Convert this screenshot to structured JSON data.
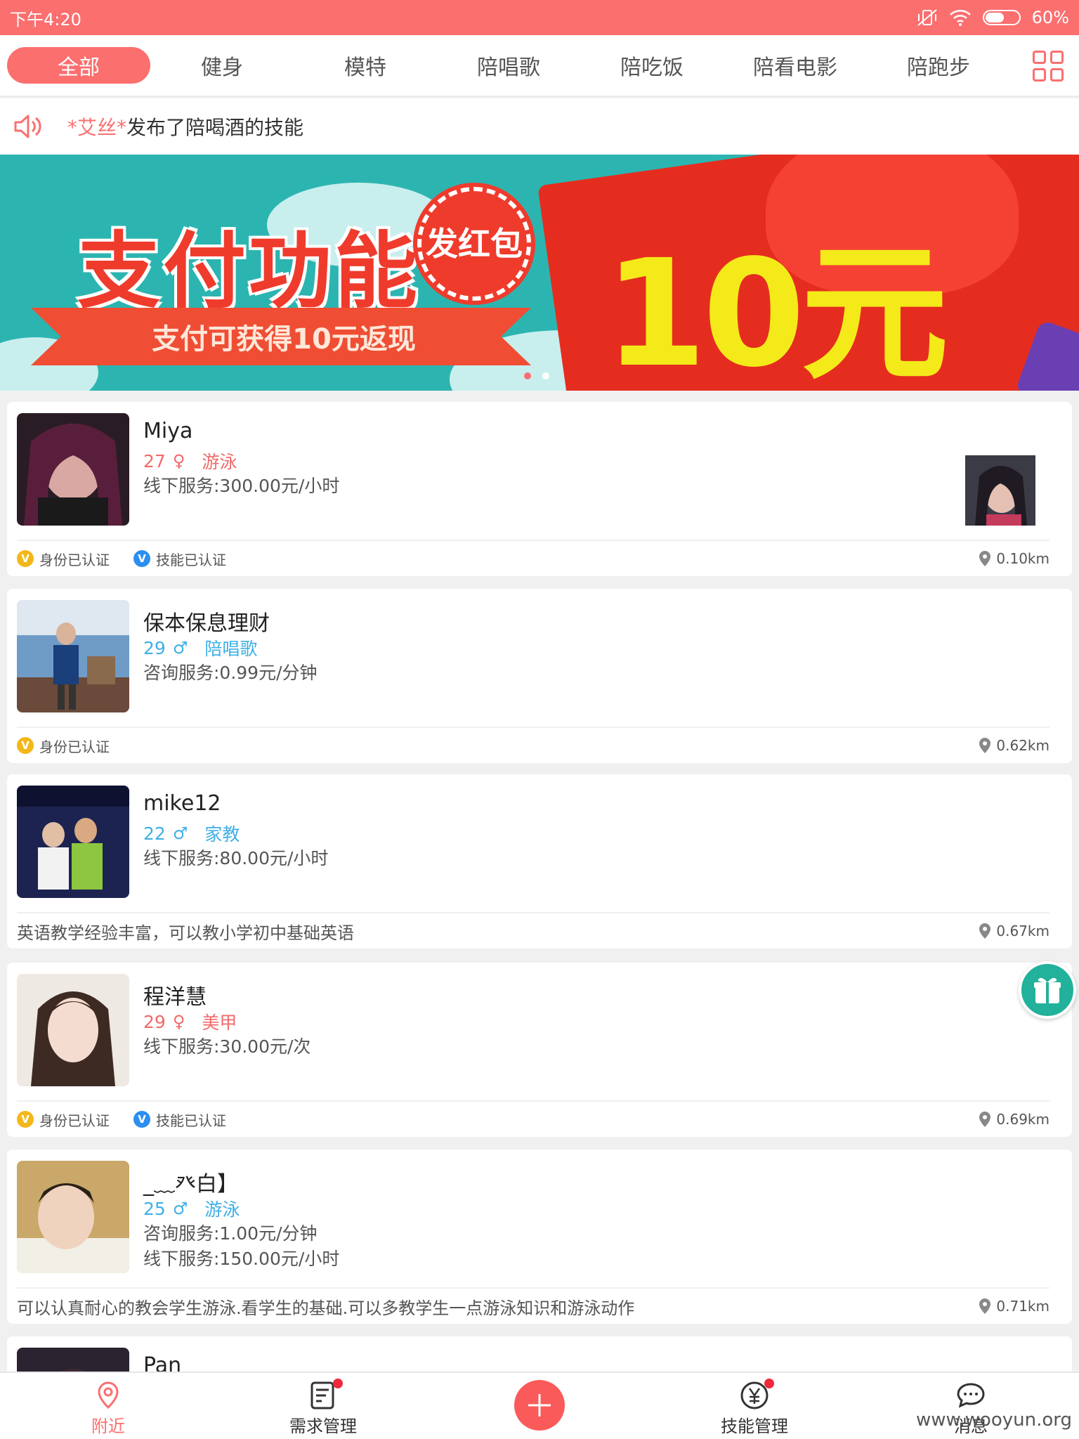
{
  "status_bar": {
    "time": "下午4:20",
    "battery_percent": "60%",
    "battery_level": 0.6
  },
  "tabs": [
    {
      "label": "全部",
      "active": true
    },
    {
      "label": "健身",
      "active": false
    },
    {
      "label": "模特",
      "active": false
    },
    {
      "label": "陪唱歌",
      "active": false
    },
    {
      "label": "陪吃饭",
      "active": false
    },
    {
      "label": "陪看电影",
      "active": false
    },
    {
      "label": "陪跑步",
      "active": false
    }
  ],
  "notice": {
    "highlight": "*艾丝*",
    "text": "发布了陪喝酒的技能",
    "icon": "speaker-icon"
  },
  "banner": {
    "title": "支付功能",
    "badge": "发红包",
    "subtitle": "支付可获得10元返现",
    "amount": "10元",
    "page_count": 2,
    "active_index": 0
  },
  "cards": [
    {
      "name": "Miya",
      "age": "27",
      "gender": "female",
      "gender_symbol": "♀",
      "skill": "游泳",
      "services": [
        "线下服务:300.00元/小时"
      ],
      "id_verified_label": "身份已认证",
      "skill_verified_label": "技能已认证",
      "description": "",
      "distance": "0.10km"
    },
    {
      "name": "保本保息理财",
      "age": "29",
      "gender": "male",
      "gender_symbol": "♂",
      "skill": "陪唱歌",
      "services": [
        "咨询服务:0.99元/分钟"
      ],
      "id_verified_label": "身份已认证",
      "skill_verified_label": "",
      "description": "",
      "distance": "0.62km"
    },
    {
      "name": "mike12",
      "age": "22",
      "gender": "male",
      "gender_symbol": "♂",
      "skill": "家教",
      "services": [
        "线下服务:80.00元/小时"
      ],
      "id_verified_label": "",
      "skill_verified_label": "",
      "description": "英语教学经验丰富，可以教小学初中基础英语",
      "distance": "0.67km"
    },
    {
      "name": "程洋慧",
      "age": "29",
      "gender": "female",
      "gender_symbol": "♀",
      "skill": "美甲",
      "services": [
        "线下服务:30.00元/次"
      ],
      "id_verified_label": "身份已认证",
      "skill_verified_label": "技能已认证",
      "description": "",
      "distance": "0.69km"
    },
    {
      "name": "_﹏癶白】",
      "age": "25",
      "gender": "male",
      "gender_symbol": "♂",
      "skill": "游泳",
      "services": [
        "咨询服务:1.00元/分钟",
        "线下服务:150.00元/小时"
      ],
      "id_verified_label": "",
      "skill_verified_label": "",
      "description": "可以认真耐心的教会学生游泳.看学生的基础.可以多教学生一点游泳知识和游泳动作",
      "distance": "0.71km"
    },
    {
      "name": "Pan"
    }
  ],
  "bottom_nav": [
    {
      "label": "附近",
      "icon": "location-icon",
      "active": true,
      "badge": false
    },
    {
      "label": "需求管理",
      "icon": "document-icon",
      "active": false,
      "badge": true
    },
    {
      "label": "",
      "icon": "plus-icon",
      "active": false,
      "badge": false
    },
    {
      "label": "技能管理",
      "icon": "yen-icon",
      "active": false,
      "badge": true
    },
    {
      "label": "消息",
      "icon": "chat-icon",
      "active": false,
      "badge": false
    }
  ],
  "watermark": "www.wooyun.org",
  "colors": {
    "accent": "#fb6f6f",
    "female": "#f26a6a",
    "male": "#3fb0e6",
    "id_badge": "#f3b71a",
    "skill_badge": "#2c8ff0",
    "gift": "#22b19b"
  }
}
